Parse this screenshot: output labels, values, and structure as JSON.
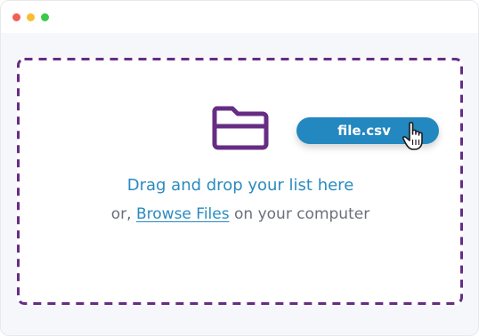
{
  "window": {
    "controls": [
      "close",
      "minimize",
      "maximize"
    ]
  },
  "colors": {
    "close": "#f25f58",
    "minimize": "#f7be32",
    "maximize": "#3ac94a",
    "accent": "#2a8bbf",
    "folder": "#662d83",
    "dash": "#662d83",
    "muted": "#6b6f7b",
    "chip": "#2387c0"
  },
  "upload": {
    "folder_icon": "folder-icon",
    "file_chip_label": "file.csv",
    "cursor_icon": "hand-pointer-icon",
    "drag_text": "Drag and drop your list here",
    "or_text": "or,",
    "browse_link": "Browse Files",
    "after_text": "on your computer"
  }
}
